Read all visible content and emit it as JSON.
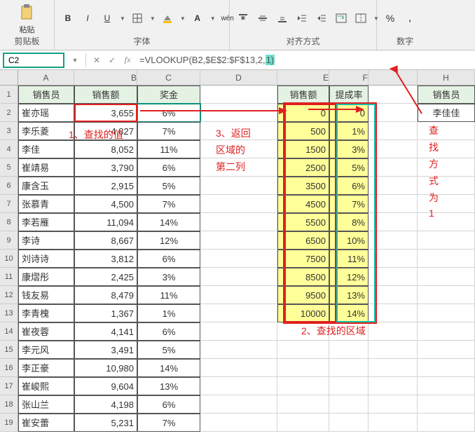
{
  "ribbon": {
    "paste_label": "粘贴",
    "group_clipboard": "剪贴板",
    "group_font": "字体",
    "group_align": "对齐方式",
    "group_number": "数字",
    "bold": "B",
    "italic": "I",
    "underline": "U",
    "wen": "wén",
    "percent": "%"
  },
  "namebox": "C2",
  "formula_prefix": "=VLOOKUP(B2,$E$2:$F$13,2,",
  "formula_hl": "1)",
  "columns": [
    "A",
    "B",
    "C",
    "D",
    "E",
    "F",
    "",
    "H"
  ],
  "headers": {
    "A": "销售员",
    "B": "销售额",
    "C": "奖金",
    "E": "销售额",
    "F": "提成率",
    "H": "销售员"
  },
  "h2": "李佳佳",
  "tableABC": [
    {
      "a": "崔亦瑶",
      "b": "3,655",
      "c": "6%"
    },
    {
      "a": "李乐菱",
      "b": "4,827",
      "c": "7%"
    },
    {
      "a": "李佳",
      "b": "8,052",
      "c": "11%"
    },
    {
      "a": "崔靖易",
      "b": "3,790",
      "c": "6%"
    },
    {
      "a": "康含玉",
      "b": "2,915",
      "c": "5%"
    },
    {
      "a": "张慕青",
      "b": "4,500",
      "c": "7%"
    },
    {
      "a": "李若雁",
      "b": "11,094",
      "c": "14%"
    },
    {
      "a": "李诗",
      "b": "8,667",
      "c": "12%"
    },
    {
      "a": "刘诗诗",
      "b": "3,812",
      "c": "6%"
    },
    {
      "a": "康熠彤",
      "b": "2,425",
      "c": "3%"
    },
    {
      "a": "钱友易",
      "b": "8,479",
      "c": "11%"
    },
    {
      "a": "李青槐",
      "b": "1,367",
      "c": "1%"
    },
    {
      "a": "崔夜蓉",
      "b": "4,141",
      "c": "6%"
    },
    {
      "a": "李元风",
      "b": "3,491",
      "c": "5%"
    },
    {
      "a": "李正豪",
      "b": "10,980",
      "c": "14%"
    },
    {
      "a": "崔峻熙",
      "b": "9,604",
      "c": "13%"
    },
    {
      "a": "张山兰",
      "b": "4,198",
      "c": "6%"
    },
    {
      "a": "崔安蕾",
      "b": "5,231",
      "c": "7%"
    }
  ],
  "tableEF": [
    {
      "e": "0",
      "f": "0"
    },
    {
      "e": "500",
      "f": "1%"
    },
    {
      "e": "1500",
      "f": "3%"
    },
    {
      "e": "2500",
      "f": "5%"
    },
    {
      "e": "3500",
      "f": "6%"
    },
    {
      "e": "4500",
      "f": "7%"
    },
    {
      "e": "5500",
      "f": "8%"
    },
    {
      "e": "6500",
      "f": "10%"
    },
    {
      "e": "7500",
      "f": "11%"
    },
    {
      "e": "8500",
      "f": "12%"
    },
    {
      "e": "9500",
      "f": "13%"
    },
    {
      "e": "10000",
      "f": "14%"
    }
  ],
  "annot1": "1、查找的值",
  "annot2": "2、查找的区域",
  "annot3a": "3、返回",
  "annot3b": "区域的",
  "annot3c": "第二列",
  "annot4a": "查",
  "annot4b": "找",
  "annot4c": "方",
  "annot4d": "式",
  "annot4e": "为",
  "annot4f": "1"
}
